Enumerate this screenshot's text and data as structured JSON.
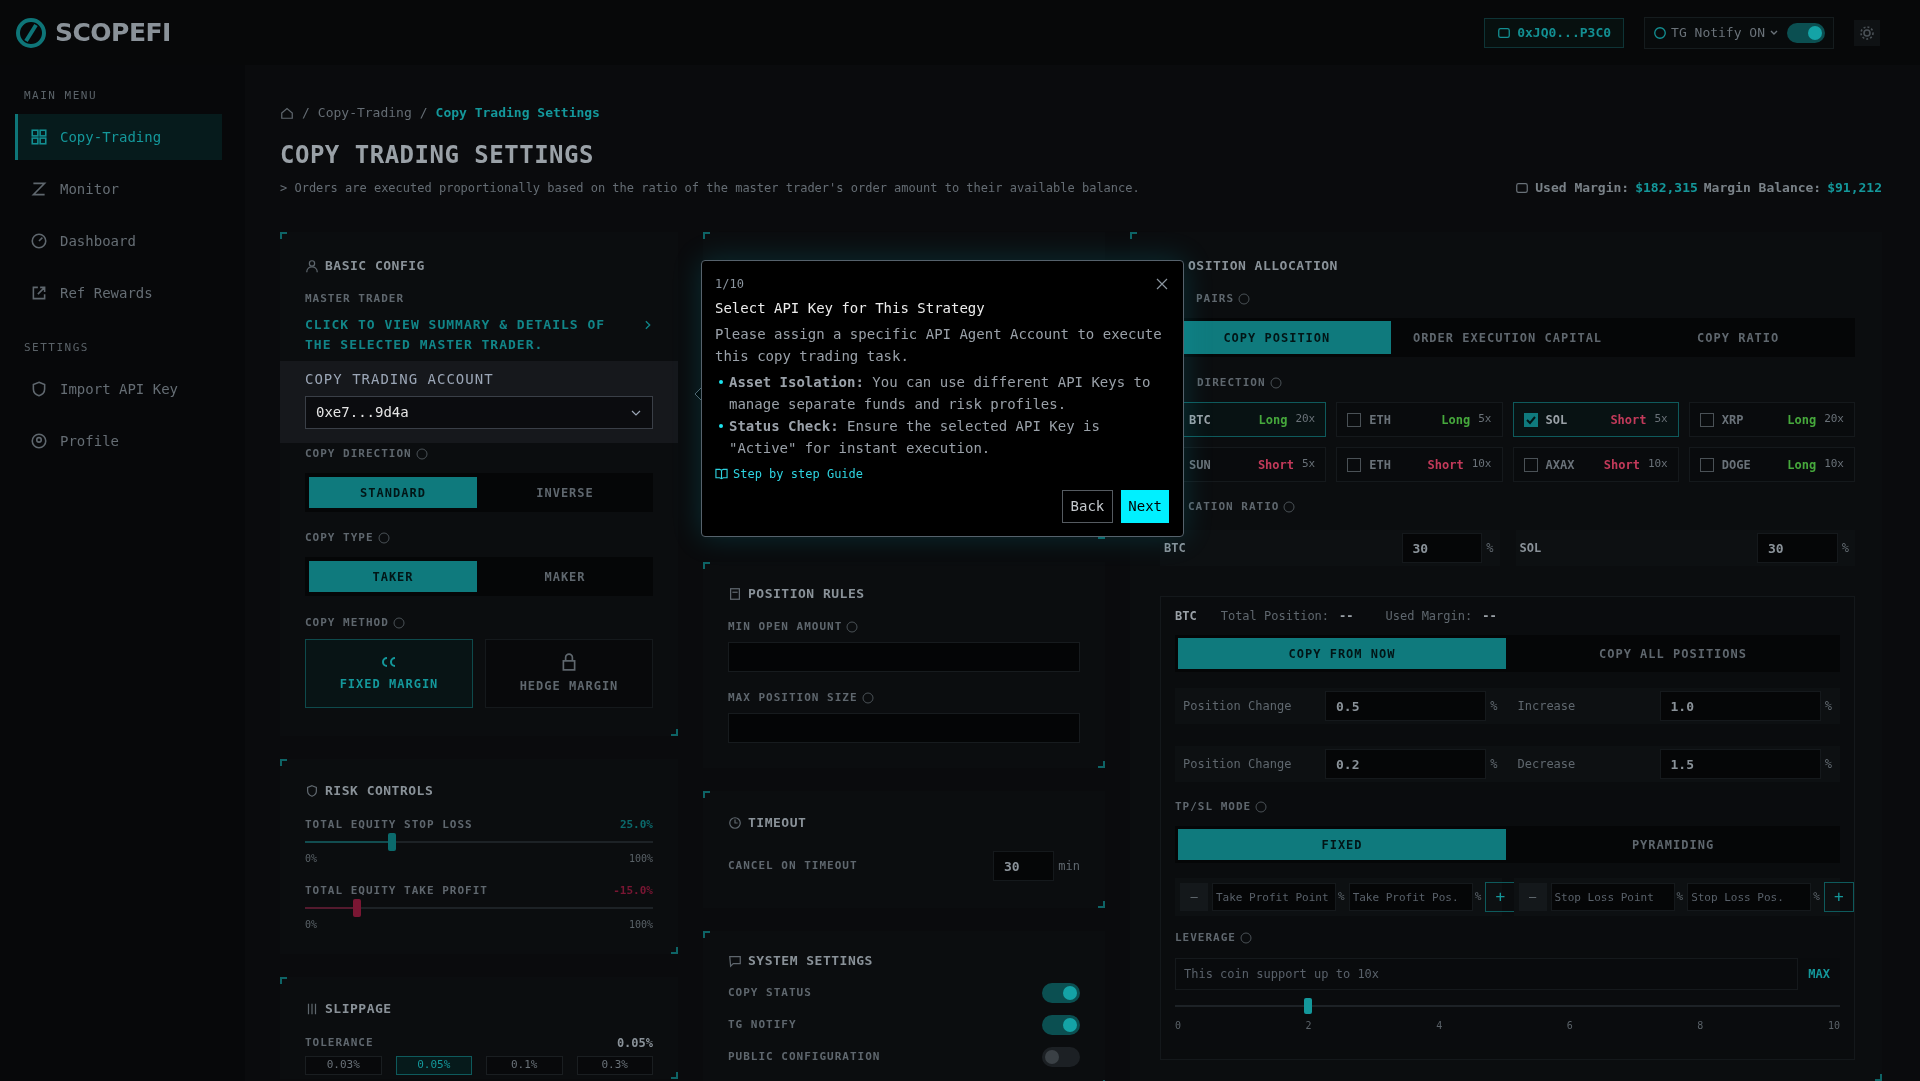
{
  "header": {
    "logo": "SCOPEFI",
    "wallet": "0xJQ0...P3C0",
    "notify": {
      "label": "TG Notify ON",
      "on": true
    }
  },
  "sidebar": {
    "sections": [
      {
        "title": "MAIN MENU",
        "items": [
          {
            "label": "Copy-Trading",
            "selected": true
          },
          {
            "label": "Monitor",
            "selected": false
          },
          {
            "label": "Dashboard",
            "selected": false
          },
          {
            "label": "Ref Rewards",
            "selected": false
          }
        ]
      },
      {
        "title": "SETTINGS",
        "items": [
          {
            "label": "Import API Key",
            "selected": false
          },
          {
            "label": "Profile",
            "selected": false
          }
        ]
      }
    ]
  },
  "breadcrumb": {
    "separator": "/",
    "items": [
      {
        "label": "Copy-Trading",
        "current": false
      },
      {
        "label": "Copy Trading Settings",
        "current": true
      }
    ]
  },
  "page": {
    "title": "COPY TRADING SETTINGS",
    "note": "> Orders are executed proportionally based on the ratio of the master trader's order amount to their available balance.",
    "margins": [
      {
        "label": "Used Margin:",
        "value": "$182,315"
      },
      {
        "label": "Margin Balance:",
        "value": "$91,212"
      }
    ]
  },
  "basic_config": {
    "title": "BASIC CONFIG",
    "master_trader": {
      "label": "MASTER TRADER",
      "link": "CLICK TO VIEW SUMMARY & DETAILS OF THE SELECTED MASTER TRADER."
    },
    "account": {
      "label": "COPY TRADING ACCOUNT",
      "value": "0xe7...9d4a"
    },
    "direction": {
      "label": "COPY DIRECTION",
      "options": [
        {
          "label": "STANDARD",
          "selected": true
        },
        {
          "label": "INVERSE",
          "selected": false
        }
      ]
    },
    "copy_type": {
      "label": "COPY TYPE",
      "options": [
        {
          "label": "TAKER",
          "selected": true
        },
        {
          "label": "MAKER",
          "selected": false
        }
      ]
    },
    "copy_method": {
      "label": "COPY METHOD",
      "options": [
        {
          "label": "FIXED MARGIN",
          "selected": true
        },
        {
          "label": "HEDGE MARGIN",
          "selected": false
        }
      ]
    }
  },
  "risk_controls": {
    "title": "RISK CONTROLS",
    "sliders": [
      {
        "label": "TOTAL EQUITY STOP LOSS",
        "reading": "25.0%",
        "level": 0.25,
        "color": "#0b6a6c",
        "min": "0%",
        "max": "100%"
      },
      {
        "label": "TOTAL EQUITY TAKE PROFIT",
        "reading": "-15.0%",
        "level": 0.15,
        "color": "#7a1633",
        "min": "0%",
        "max": "100%"
      }
    ]
  },
  "slippage": {
    "title": "SLIPPAGE",
    "tolerance": {
      "label": "TOLERANCE",
      "value": "0.05%"
    },
    "options": [
      {
        "label": "0.03%",
        "selected": false
      },
      {
        "label": "0.05%",
        "selected": true
      },
      {
        "label": "0.1%",
        "selected": false
      },
      {
        "label": "0.3%",
        "selected": false
      }
    ]
  },
  "position_rules": {
    "title": "POSITION RULES",
    "fields": [
      {
        "label": "MIN OPEN AMOUNT"
      },
      {
        "label": "MAX POSITION SIZE"
      }
    ]
  },
  "timeout": {
    "title": "TIMEOUT",
    "label": "CANCEL ON TIMEOUT",
    "value": "30",
    "unit": "min"
  },
  "system_settings": {
    "title": "SYSTEM SETTINGS",
    "toggles": [
      {
        "label": "COPY STATUS",
        "on": true
      },
      {
        "label": "TG NOTIFY",
        "on": true
      },
      {
        "label": "PUBLIC CONFIGURATION",
        "on": false
      }
    ]
  },
  "allocation": {
    "title": "OSITION ALLOCATION",
    "pairs_label": "PAIRS",
    "tabs": [
      {
        "label": "COPY POSITION",
        "selected": true
      },
      {
        "label": "ORDER EXECUTION CAPITAL",
        "selected": false
      },
      {
        "label": "COPY RATIO",
        "selected": false
      }
    ],
    "direction_label": "DIRECTION",
    "pairs": [
      {
        "symbol": "BTC",
        "selected": true,
        "kind": "long",
        "side": "Long",
        "leverage": "20x"
      },
      {
        "symbol": "ETH",
        "checked": false,
        "selected": false,
        "kind": "long",
        "side": "Long",
        "leverage": "5x"
      },
      {
        "symbol": "SOL",
        "checked": true,
        "selected": true,
        "kind": "short",
        "side": "Short",
        "leverage": "5x"
      },
      {
        "symbol": "XRP",
        "checked": false,
        "selected": false,
        "kind": "long",
        "side": "Long",
        "leverage": "20x"
      },
      {
        "symbol": "SUN",
        "selected": false,
        "kind": "short",
        "side": "Short",
        "leverage": "5x"
      },
      {
        "symbol": "ETH",
        "checked": false,
        "selected": false,
        "kind": "short",
        "side": "Short",
        "leverage": "10x"
      },
      {
        "symbol": "AXAX",
        "checked": false,
        "selected": false,
        "kind": "short",
        "side": "Short",
        "leverage": "10x"
      },
      {
        "symbol": "DOGE",
        "checked": false,
        "selected": false,
        "kind": "long",
        "side": "Long",
        "leverage": "10x"
      }
    ],
    "ratio_label": "CATION RATIO",
    "ratios": [
      {
        "symbol": "BTC",
        "value": "30",
        "unit": "%"
      },
      {
        "symbol": "SOL",
        "value": "30",
        "unit": "%"
      }
    ],
    "detail": {
      "symbol": "BTC",
      "stats": [
        {
          "label": "Total Position:",
          "value": "--"
        },
        {
          "label": "Used Margin:",
          "value": "--"
        }
      ],
      "tabs": [
        {
          "label": "COPY FROM NOW",
          "selected": true
        },
        {
          "label": "COPY ALL POSITIONS",
          "selected": false
        }
      ],
      "rows": [
        [
          {
            "label": "Position Change",
            "value": "0.5",
            "unit": "%"
          },
          {
            "label": "Increase",
            "value": "1.0",
            "unit": "%"
          }
        ],
        [
          {
            "label": "Position Change",
            "value": "0.2",
            "unit": "%"
          },
          {
            "label": "Decrease",
            "value": "1.5",
            "unit": "%"
          }
        ]
      ],
      "tpsl_label": "TP/SL MODE",
      "tpsl_tabs": [
        {
          "label": "FIXED",
          "selected": true
        },
        {
          "label": "PYRAMIDING",
          "selected": false
        }
      ],
      "tpsl_groups": [
        {
          "minus": "—",
          "fields": [
            {
              "placeholder": "Take Profit Point",
              "unit": "%"
            },
            {
              "placeholder": "Take Profit Pos.",
              "unit": "%"
            }
          ],
          "plus": "+"
        },
        {
          "minus": "—",
          "fields": [
            {
              "placeholder": "Stop Loss Point",
              "unit": "%"
            },
            {
              "placeholder": "Stop Loss Pos.",
              "unit": "%"
            }
          ],
          "plus": "+"
        }
      ],
      "leverage": {
        "label": "LEVERAGE",
        "placeholder": "This coin support up to 10x",
        "max": "MAX",
        "level": 0.2,
        "ticks": [
          "0",
          "2",
          "4",
          "6",
          "8",
          "10"
        ]
      }
    }
  },
  "tour": {
    "step": "1/10",
    "title": "Select API Key for This Strategy",
    "body": "Please assign a specific API Agent Account to execute this copy trading task.",
    "bullets": [
      "**Asset Isolation:** You can use different API Keys to manage separate funds and risk profiles.",
      "**Status Check:** Ensure the selected API Key is \"Active\" for instant execution."
    ],
    "guide": "Step by step Guide",
    "back": "Back",
    "next": "Next"
  }
}
